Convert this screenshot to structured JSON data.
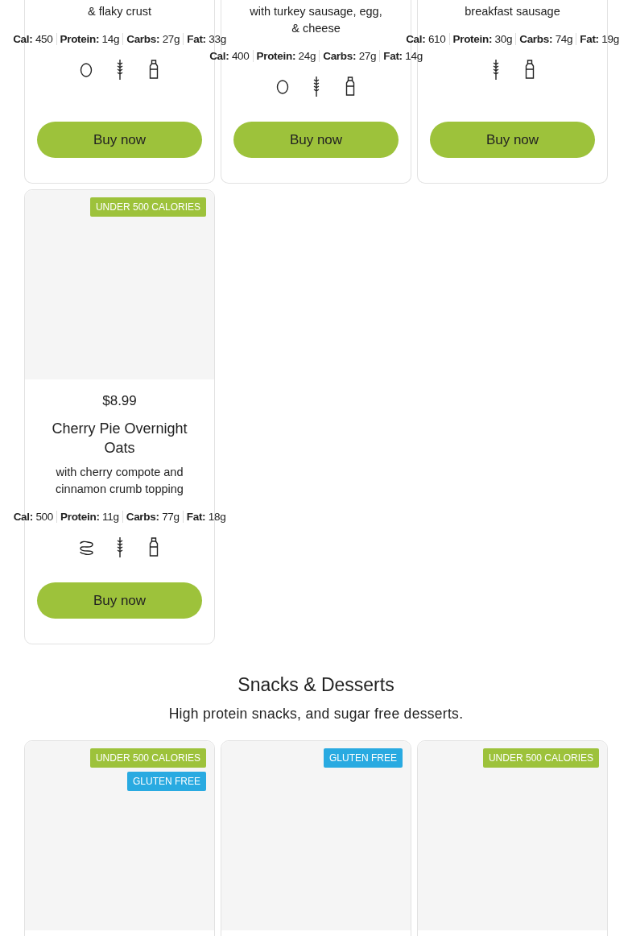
{
  "top_row": [
    {
      "description": "& flaky crust",
      "macros": [
        {
          "label": "Cal:",
          "value": "450"
        },
        {
          "label": "Protein:",
          "value": "14g"
        },
        {
          "label": "Carbs:",
          "value": "27g"
        },
        {
          "label": "Fat:",
          "value": "33g"
        }
      ],
      "allergens": [
        {
          "kind": "egg"
        },
        {
          "kind": "wheat"
        },
        {
          "kind": "milk"
        }
      ],
      "button": "Buy now"
    },
    {
      "description": "with turkey sausage, egg, & cheese",
      "macros": [
        {
          "label": "Cal:",
          "value": "400"
        },
        {
          "label": "Protein:",
          "value": "24g"
        },
        {
          "label": "Carbs:",
          "value": "27g"
        },
        {
          "label": "Fat:",
          "value": "14g"
        }
      ],
      "allergens": [
        {
          "kind": "egg"
        },
        {
          "kind": "wheat"
        },
        {
          "kind": "milk"
        }
      ],
      "button": "Buy now"
    },
    {
      "description": "breakfast sausage",
      "macros": [
        {
          "label": "Cal:",
          "value": "610"
        },
        {
          "label": "Protein:",
          "value": "30g"
        },
        {
          "label": "Carbs:",
          "value": "74g"
        },
        {
          "label": "Fat:",
          "value": "19g"
        }
      ],
      "allergens": [
        {
          "kind": "wheat"
        },
        {
          "kind": "milk"
        }
      ],
      "button": "Buy now"
    }
  ],
  "second_row": [
    {
      "badges": [
        {
          "text": "UNDER 500 CALORIES",
          "color": "#9dc23b"
        }
      ],
      "price": "$8.99",
      "name": "Cherry Pie Overnight Oats",
      "description": "with cherry compote and cinnamon crumb topping",
      "macros": [
        {
          "label": "Cal:",
          "value": "500"
        },
        {
          "label": "Protein:",
          "value": "11g"
        },
        {
          "label": "Carbs:",
          "value": "77g"
        },
        {
          "label": "Fat:",
          "value": "18g"
        }
      ],
      "allergens": [
        {
          "kind": "nut"
        },
        {
          "kind": "wheat"
        },
        {
          "kind": "milk"
        }
      ],
      "button": "Buy now"
    }
  ],
  "section": {
    "title": "Snacks & Desserts",
    "subtitle": "High protein snacks, and sugar free desserts.",
    "items": [
      {
        "badges": [
          {
            "text": "UNDER 500 CALORIES",
            "color": "#9dc23b"
          },
          {
            "text": "GLUTEN FREE",
            "color": "#29aae1"
          }
        ]
      },
      {
        "badges": [
          {
            "text": "GLUTEN FREE",
            "color": "#29aae1"
          }
        ]
      },
      {
        "badges": [
          {
            "text": "UNDER 500 CALORIES",
            "color": "#9dc23b"
          }
        ]
      }
    ]
  }
}
